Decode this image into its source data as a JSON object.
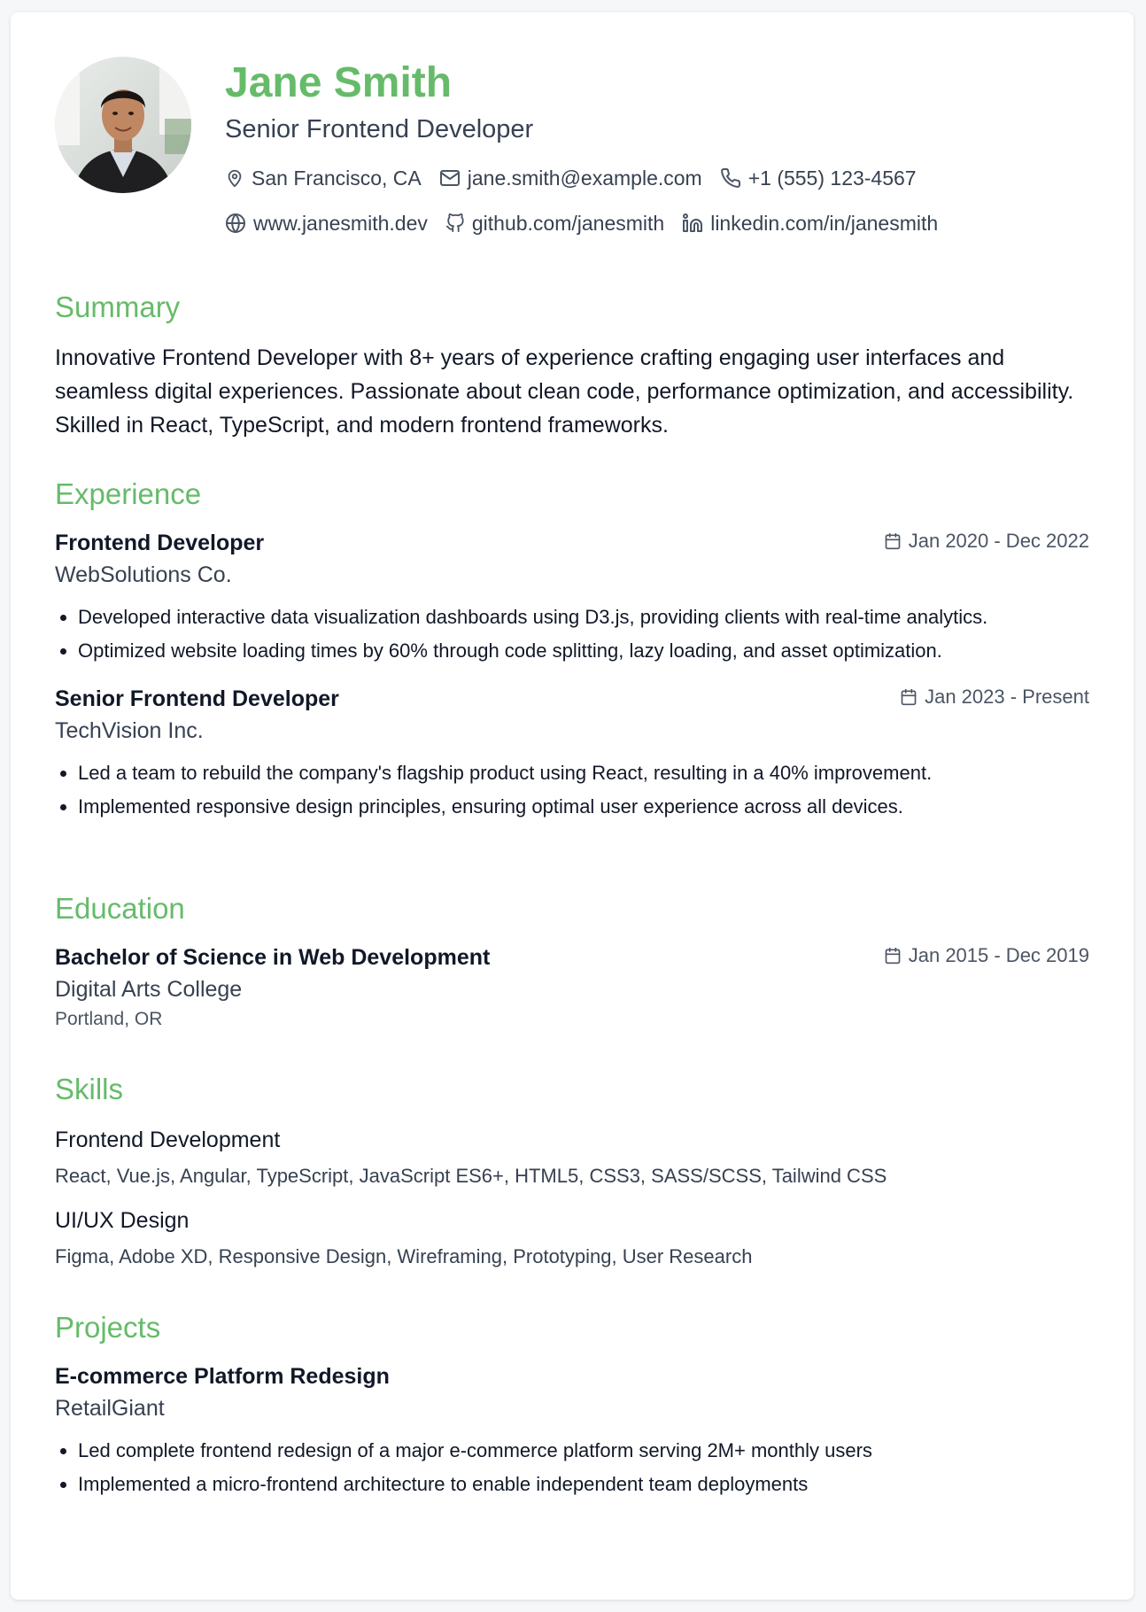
{
  "colors": {
    "accent": "#66bb6a",
    "text": "#111827",
    "muted": "#374151"
  },
  "header": {
    "name": "Jane Smith",
    "title": "Senior Frontend Developer",
    "contact_row1": [
      {
        "icon": "map-pin-icon",
        "text": "San Francisco, CA"
      },
      {
        "icon": "mail-icon",
        "text": "jane.smith@example.com"
      },
      {
        "icon": "phone-icon",
        "text": "+1 (555) 123-4567"
      }
    ],
    "contact_row2": [
      {
        "icon": "globe-icon",
        "text": "www.janesmith.dev"
      },
      {
        "icon": "github-icon",
        "text": "github.com/janesmith"
      },
      {
        "icon": "linkedin-icon",
        "text": "linkedin.com/in/janesmith"
      }
    ]
  },
  "summary": {
    "heading": "Summary",
    "text": "Innovative Frontend Developer with 8+ years of experience crafting engaging user interfaces and seamless digital experiences. Passionate about clean code, performance optimization, and accessibility. Skilled in React, TypeScript, and modern frontend frameworks."
  },
  "experience": {
    "heading": "Experience",
    "items": [
      {
        "title": "Frontend Developer",
        "company": "WebSolutions Co.",
        "dates": "Jan 2020 - Dec 2022",
        "bullets": [
          "Developed interactive data visualization dashboards using D3.js, providing clients with real-time analytics.",
          "Optimized website loading times by 60% through code splitting, lazy loading, and asset optimization."
        ]
      },
      {
        "title": "Senior Frontend Developer",
        "company": "TechVision Inc.",
        "dates": "Jan 2023 - Present",
        "bullets": [
          "Led a team to rebuild the company's flagship product using React, resulting in a 40% improvement.",
          "Implemented responsive design principles, ensuring optimal user experience across all devices."
        ]
      }
    ]
  },
  "education": {
    "heading": "Education",
    "items": [
      {
        "degree": "Bachelor of Science in Web Development",
        "school": "Digital Arts College",
        "location": "Portland, OR",
        "dates": "Jan 2015 - Dec 2019"
      }
    ]
  },
  "skills": {
    "heading": "Skills",
    "categories": [
      {
        "name": "Frontend Development",
        "list": "React, Vue.js, Angular, TypeScript, JavaScript ES6+, HTML5, CSS3, SASS/SCSS, Tailwind CSS"
      },
      {
        "name": "UI/UX Design",
        "list": "Figma, Adobe XD, Responsive Design, Wireframing, Prototyping, User Research"
      }
    ]
  },
  "projects": {
    "heading": "Projects",
    "items": [
      {
        "title": "E-commerce Platform Redesign",
        "client": "RetailGiant",
        "bullets": [
          "Led complete frontend redesign of a major e-commerce platform serving 2M+ monthly users",
          "Implemented a micro-frontend architecture to enable independent team deployments"
        ]
      }
    ]
  }
}
